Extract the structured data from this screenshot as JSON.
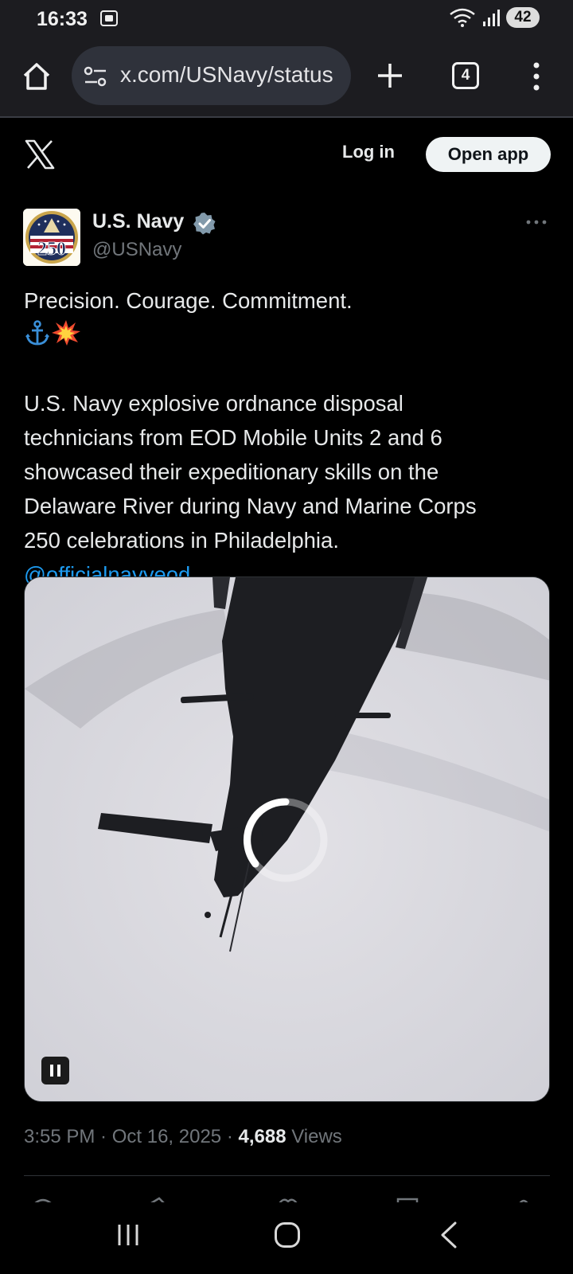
{
  "status_bar": {
    "time": "16:33",
    "battery": "42",
    "icons": [
      "screen-record-icon",
      "wifi-icon",
      "signal-icon",
      "battery-icon"
    ]
  },
  "browser": {
    "url": "x.com/USNavy/status",
    "tab_count": "4",
    "icons": [
      "home-icon",
      "site-settings-icon",
      "new-tab-icon",
      "tabs-icon",
      "more-vert-icon"
    ]
  },
  "x_header": {
    "login_label": "Log in",
    "open_app_label": "Open app"
  },
  "tweet": {
    "author_name": "U.S. Navy",
    "author_handle": "@USNavy",
    "avatar_text": "250",
    "headline": "Precision. Courage. Commitment.",
    "headline_emojis": [
      "anchor",
      "collision"
    ],
    "body": "U.S. Navy explosive ordnance disposal\ntechnicians from EOD Mobile Units 2 and 6\nshowcased their expeditionary skills on the\nDelaware River during Navy and Marine Corps\n250 celebrations in Philadelphia.",
    "mention": "@officialnavyeod",
    "media": {
      "type": "video",
      "state": "loading",
      "playback": "playing"
    },
    "time": "3:55 PM",
    "date": "Oct 16, 2025",
    "views_count": "4,688",
    "views_label": "Views"
  },
  "colors": {
    "accent": "#1d9bf0",
    "background": "#000000",
    "text_primary": "#e7e9ea",
    "text_secondary": "#71767b",
    "verified_badge": "#829aab"
  }
}
